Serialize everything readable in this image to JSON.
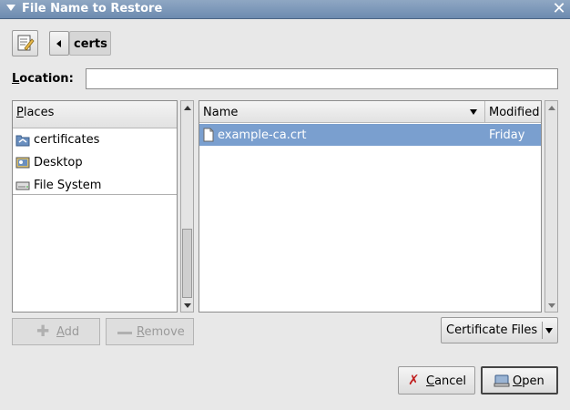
{
  "window": {
    "title": "File Name to Restore"
  },
  "toolbar": {
    "path_segment": "certs"
  },
  "location": {
    "label_underline": "L",
    "label_rest": "ocation:",
    "value": ""
  },
  "places": {
    "header_underline": "P",
    "header_rest": "laces",
    "items": [
      {
        "label": "certificates",
        "icon": "folder-icon"
      },
      {
        "label": "Desktop",
        "icon": "desktop-icon"
      },
      {
        "label": "File System",
        "icon": "harddisk-icon"
      }
    ]
  },
  "files": {
    "name_header": "Name",
    "modified_header": "Modified",
    "rows": [
      {
        "name": "example-ca.crt",
        "modified": "Friday",
        "selected": true
      }
    ]
  },
  "buttons": {
    "add_pre": "",
    "add_underline": "A",
    "add_rest": "dd",
    "remove_pre": "",
    "remove_underline": "R",
    "remove_rest": "emove",
    "cancel_underline": "C",
    "cancel_rest": "ancel",
    "open_underline": "O",
    "open_rest": "pen"
  },
  "filter": {
    "selected": "Certificate Files"
  },
  "colors": {
    "selection": "#7a9fcf",
    "titlebar": "#7e99ba"
  }
}
